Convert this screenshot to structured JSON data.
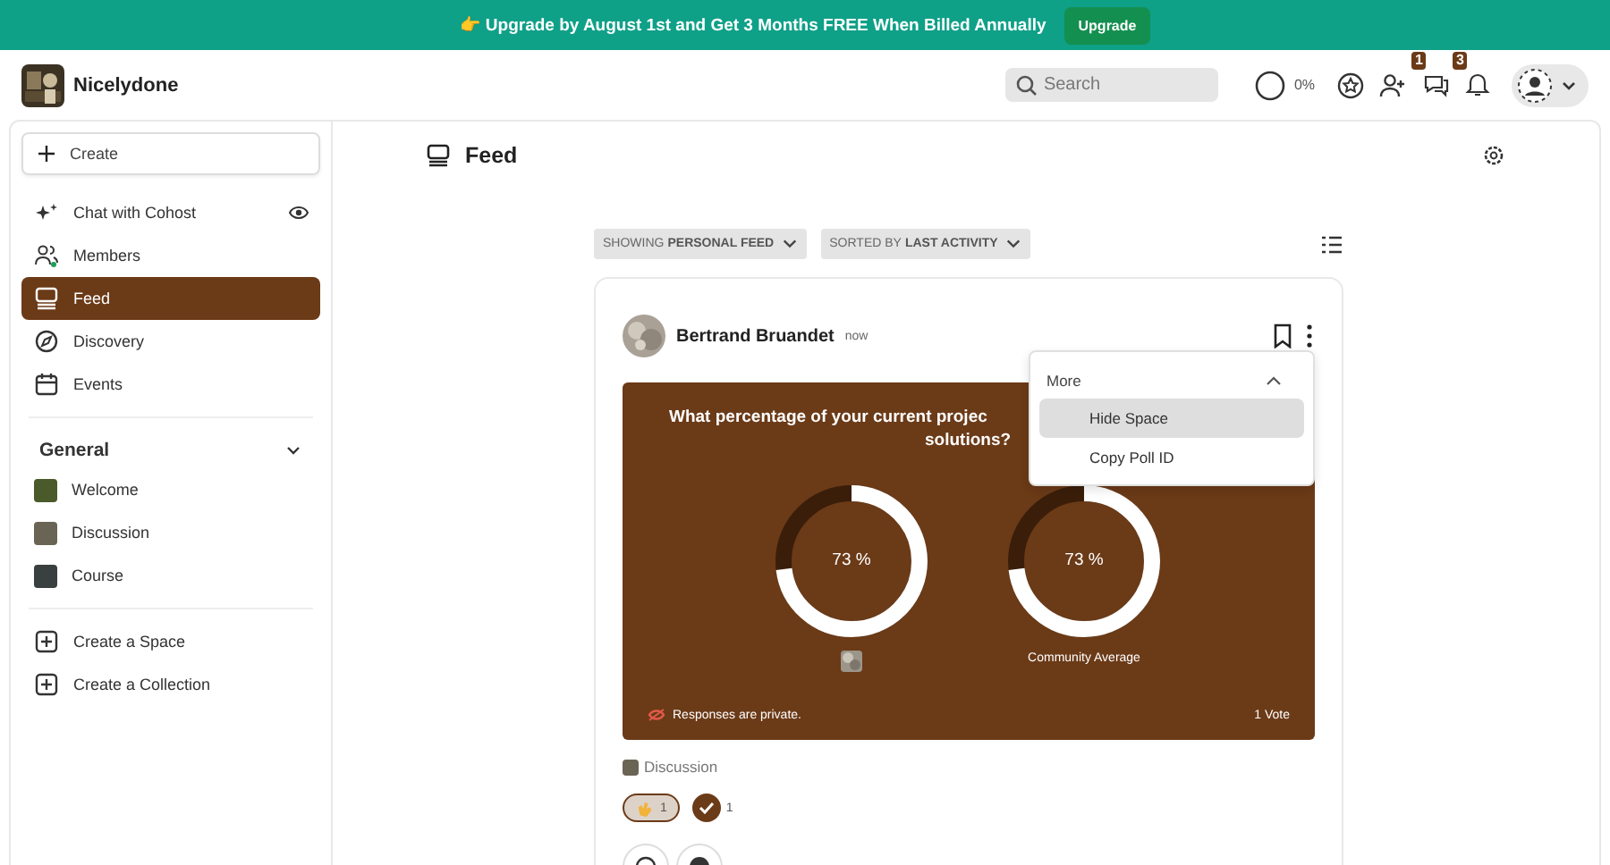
{
  "banner": {
    "icon": "👉",
    "text": "Upgrade by August 1st and Get 3 Months FREE When Billed Annually",
    "button": "Upgrade"
  },
  "header": {
    "brand": "Nicelydone",
    "search": {
      "placeholder": "Search"
    },
    "progress": {
      "level": 0,
      "reading": "0%"
    },
    "messages_badge": "1",
    "notifications_badge": "3"
  },
  "sidebar": {
    "create": "Create",
    "items": [
      {
        "label": "Chat with Cohost",
        "kind": "chat",
        "selected": false
      },
      {
        "label": "Members",
        "kind": "members",
        "selected": false
      },
      {
        "label": "Feed",
        "kind": "feed",
        "selected": true
      },
      {
        "label": "Discovery",
        "kind": "discovery",
        "selected": false
      },
      {
        "label": "Events",
        "kind": "events",
        "selected": false
      }
    ],
    "section": {
      "title": "General",
      "expanded": true,
      "spaces": [
        {
          "label": "Welcome",
          "color": "#4a5a2a"
        },
        {
          "label": "Discussion",
          "color": "#6a6455"
        },
        {
          "label": "Course",
          "color": "#3a4040"
        }
      ]
    },
    "actions": [
      "Create a Space",
      "Create a Collection"
    ]
  },
  "main": {
    "title": "Feed",
    "filters": [
      {
        "prefix": "SHOWING",
        "value": "PERSONAL FEED"
      },
      {
        "prefix": "SORTED BY",
        "value": "LAST ACTIVITY"
      }
    ],
    "post": {
      "author": "Bertrand Bruandet",
      "time": "now",
      "poll": {
        "question_lines": [
          "What percentage of your current projec",
          "solutions?"
        ],
        "results": [
          {
            "level": 0.73,
            "reading": "73 %",
            "kind": "avatar"
          },
          {
            "level": 0.73,
            "reading": "73 %",
            "kind": "label",
            "label": "Community Average"
          }
        ],
        "privacy": "Responses are private.",
        "votes": "1 Vote"
      },
      "space": "Discussion",
      "reactions": [
        {
          "kind": "clap",
          "count": "1",
          "selected": true
        },
        {
          "kind": "check",
          "count": "1",
          "selected": false
        }
      ]
    },
    "menu": {
      "title": "More",
      "items": [
        {
          "label": "Hide Space",
          "selected": true
        },
        {
          "label": "Copy Poll ID",
          "selected": false
        }
      ]
    }
  }
}
